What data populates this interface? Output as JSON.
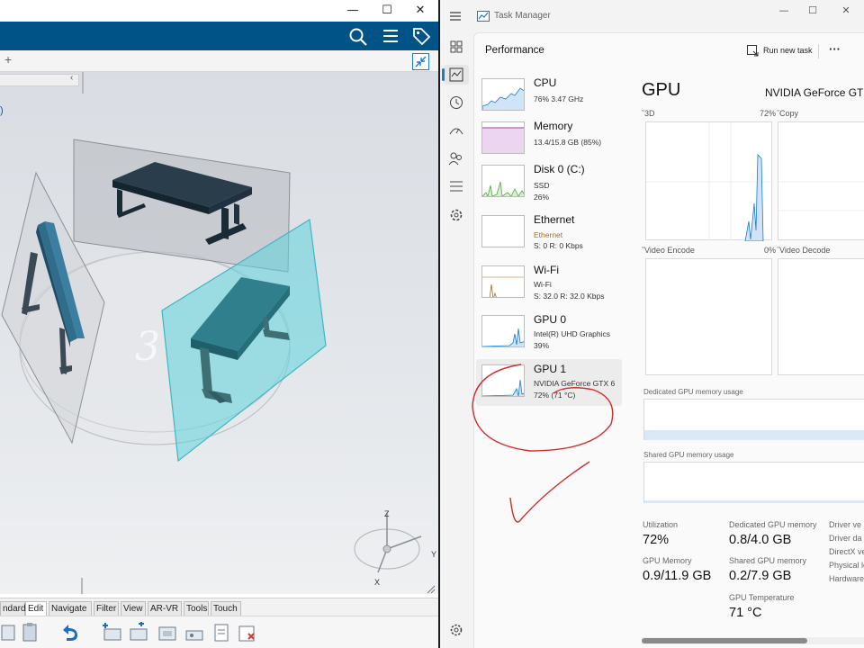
{
  "cad": {
    "window_controls": {
      "minimize": "—",
      "maximize": "☐",
      "close": "✕"
    },
    "tab_plus": "+",
    "tree_paren": ")",
    "compass": {
      "z": "Z",
      "y": "Y",
      "x": "X"
    },
    "menu_tabs": [
      "ndard",
      "Edit",
      "Navigate",
      "Filter",
      "View",
      "AR-VR",
      "Tools",
      "Touch"
    ],
    "active_menu_tab": "Edit",
    "colors": {
      "header": "#005386",
      "table_dark": "#1f3a4a",
      "table_blue": "#2f6d8a",
      "glass_cyan": "#5fd3dc"
    }
  },
  "tm": {
    "title": "Task Manager",
    "window_controls": {
      "minimize": "—",
      "maximize": "☐",
      "close": "✕"
    },
    "section_title": "Performance",
    "run_new_task": "Run new task",
    "more": "···",
    "devices": [
      {
        "name": "CPU",
        "sub1": "76%  3.47 GHz",
        "sub2": "",
        "color": "#1a7bd6"
      },
      {
        "name": "Memory",
        "sub1": "13.4/15.8 GB (85%)",
        "sub2": "",
        "color": "#a040a0"
      },
      {
        "name": "Disk 0 (C:)",
        "sub1": "SSD",
        "sub2": "26%",
        "color": "#4bab3b"
      },
      {
        "name": "Ethernet",
        "sub1": "Ethernet",
        "sub2": "S: 0  R: 0 Kbps",
        "color": "#a86d1f"
      },
      {
        "name": "Wi-Fi",
        "sub1": "Wi-Fi",
        "sub2": "S: 32.0  R: 32.0 Kbps",
        "color": "#a86d1f"
      },
      {
        "name": "GPU 0",
        "sub1": "Intel(R) UHD Graphics",
        "sub2": "39%",
        "color": "#1a7bd6"
      },
      {
        "name": "GPU 1",
        "sub1": "NVIDIA GeForce GTX 6",
        "sub2": "72% (71 °C)",
        "color": "#1a7bd6"
      }
    ],
    "gpu": {
      "heading": "GPU",
      "model": "NVIDIA GeForce GT",
      "engines": [
        {
          "label": "3D",
          "pct": "72%"
        },
        {
          "label": "Copy",
          "pct": ""
        },
        {
          "label": "Video Encode",
          "pct": "0%"
        },
        {
          "label": "Video Decode",
          "pct": ""
        }
      ],
      "dedicated_label": "Dedicated GPU memory usage",
      "shared_label": "Shared GPU memory usage",
      "stats": {
        "utilization_label": "Utilization",
        "utilization": "72%",
        "dedicated_mem_label": "Dedicated GPU memory",
        "dedicated_mem": "0.8/4.0 GB",
        "gpu_memory_label": "GPU Memory",
        "gpu_memory": "0.9/11.9 GB",
        "shared_mem_label": "Shared GPU memory",
        "shared_mem": "0.2/7.9 GB",
        "temp_label": "GPU Temperature",
        "temp": "71 °C"
      },
      "side_labels": [
        "Driver ve",
        "Driver da",
        "DirectX ve",
        "Physical lo",
        "Hardware"
      ]
    }
  }
}
